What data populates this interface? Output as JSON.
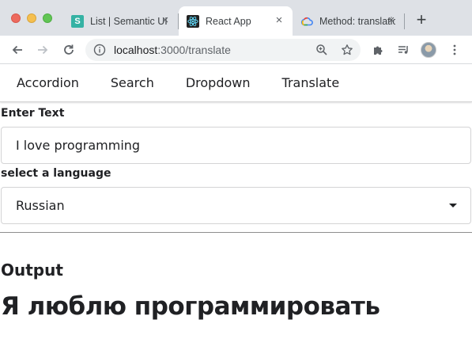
{
  "browser": {
    "tabs": [
      {
        "title": "List | Semantic UI",
        "favicon": "semantic-ui-favicon",
        "active": false
      },
      {
        "title": "React App",
        "favicon": "react-favicon",
        "active": true
      },
      {
        "title": "Method: translations",
        "favicon": "google-cloud-favicon",
        "active": false
      }
    ],
    "new_tab_label": "+",
    "url_host": "localhost",
    "url_path": ":3000/translate",
    "close_glyph": "×"
  },
  "menu": {
    "items": [
      "Accordion",
      "Search",
      "Dropdown",
      "Translate"
    ]
  },
  "form": {
    "text_label": "Enter Text",
    "text_value": "I love programming",
    "language_label": "select a language",
    "language_value": "Russian"
  },
  "output": {
    "label": "Output",
    "text": "Я люблю программировать"
  },
  "colors": {
    "tabbar_bg": "#dee1e6",
    "react_blue": "#61dafb",
    "semantic_teal": "#35b2a4"
  }
}
